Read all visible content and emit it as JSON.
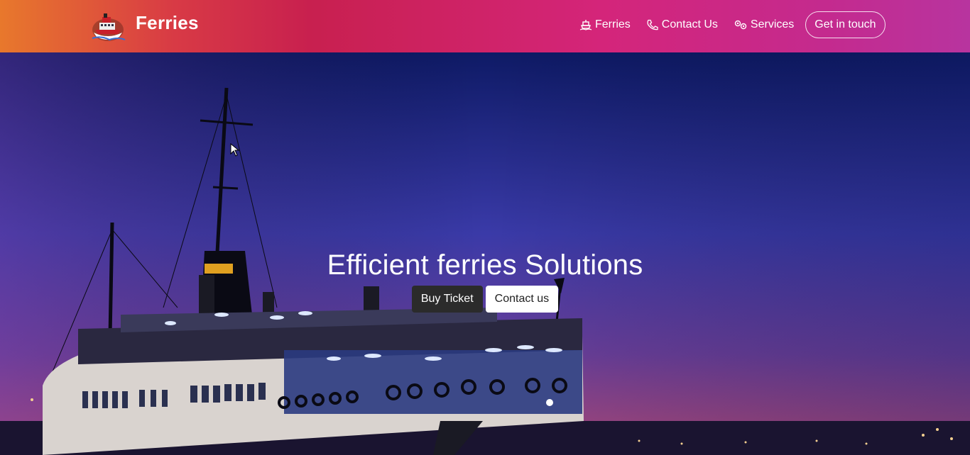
{
  "navbar": {
    "brand": {
      "name": "Ferries",
      "logo_icon": "ferry-logo-icon"
    },
    "links": [
      {
        "label": "Ferries",
        "icon": "ship-icon"
      },
      {
        "label": "Contact Us",
        "icon": "phone-icon"
      },
      {
        "label": "Services",
        "icon": "gears-icon"
      }
    ],
    "cta_label": "Get in touch"
  },
  "hero": {
    "title": "Efficient ferries Solutions",
    "primary_button": "Buy Ticket",
    "secondary_button": "Contact us"
  },
  "colors": {
    "nav_gradient_start": "#e8782c",
    "nav_gradient_mid": "#c8204f",
    "nav_gradient_end": "#b8349f",
    "sky_top": "#0e1a66",
    "sky_bottom": "#b04a7a"
  }
}
